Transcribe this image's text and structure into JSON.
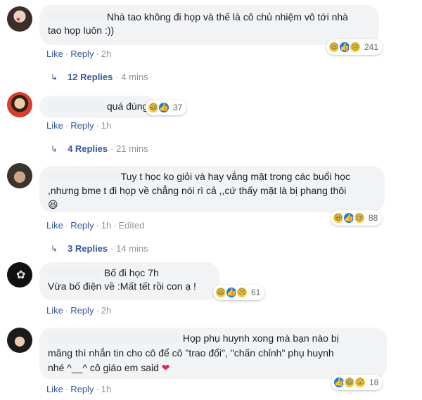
{
  "comments": [
    {
      "lines": [
        "Nhà tao không đi họp và thế là cô chủ nhiệm vô tới nhà",
        "tao họp luôn :))"
      ],
      "reactions": [
        "haha",
        "like",
        "sad"
      ],
      "reaction_count": "241",
      "actions": {
        "like": "Like",
        "reply": "Reply",
        "time": "2h"
      },
      "replies": {
        "label": "12 Replies",
        "time": "4 mins"
      }
    },
    {
      "lines": [
        "quá đúng"
      ],
      "reactions": [
        "haha",
        "like"
      ],
      "reaction_count": "37",
      "actions": {
        "like": "Like",
        "reply": "Reply",
        "time": "1h"
      },
      "replies": {
        "label": "4 Replies",
        "time": "21 mins"
      }
    },
    {
      "lines": [
        "Tuy t học ko giỏi và hay vắng mặt trong các buổi học",
        ",nhưng bme t đi họp về chẳng nói rì cả ,,cứ thấy mặt là bị phang thôi",
        "😆"
      ],
      "reactions": [
        "haha",
        "like",
        "sad"
      ],
      "reaction_count": "88",
      "actions": {
        "like": "Like",
        "reply": "Reply",
        "time": "1h",
        "edited": "Edited"
      },
      "replies": {
        "label": "3 Replies",
        "time": "14 mins"
      }
    },
    {
      "lines": [
        "Bố đi học 7h",
        "Vừa bố điện về :Mất tết rồi con ạ !"
      ],
      "reactions": [
        "haha",
        "like",
        "sad"
      ],
      "reaction_count": "61",
      "actions": {
        "like": "Like",
        "reply": "Reply",
        "time": "2h"
      }
    },
    {
      "lines": [
        "Họp phụ huynh xong mà bạn nào bị",
        "măng thì nhắn tin cho cô để cô \"trao đổi\", \"chấn chỉnh\" phụ huynh",
        "nhé ^__^ cô giáo em said"
      ],
      "reactions": [
        "like",
        "haha",
        "wow"
      ],
      "reaction_count": "18",
      "actions": {
        "like": "Like",
        "reply": "Reply",
        "time": "1h"
      }
    }
  ],
  "colors": {
    "link": "#385898",
    "meta": "#90949c",
    "bubble": "#f2f3f5",
    "like": "#1877f2",
    "emoji": "#f7c931",
    "heart": "#e0245e"
  },
  "icons": {
    "haha": "haha-emoji-icon",
    "like": "thumbs-up-icon",
    "sad": "sad-emoji-icon",
    "wow": "wow-emoji-icon",
    "heart": "heart-icon",
    "reply_arrow": "reply-arrow-icon"
  }
}
